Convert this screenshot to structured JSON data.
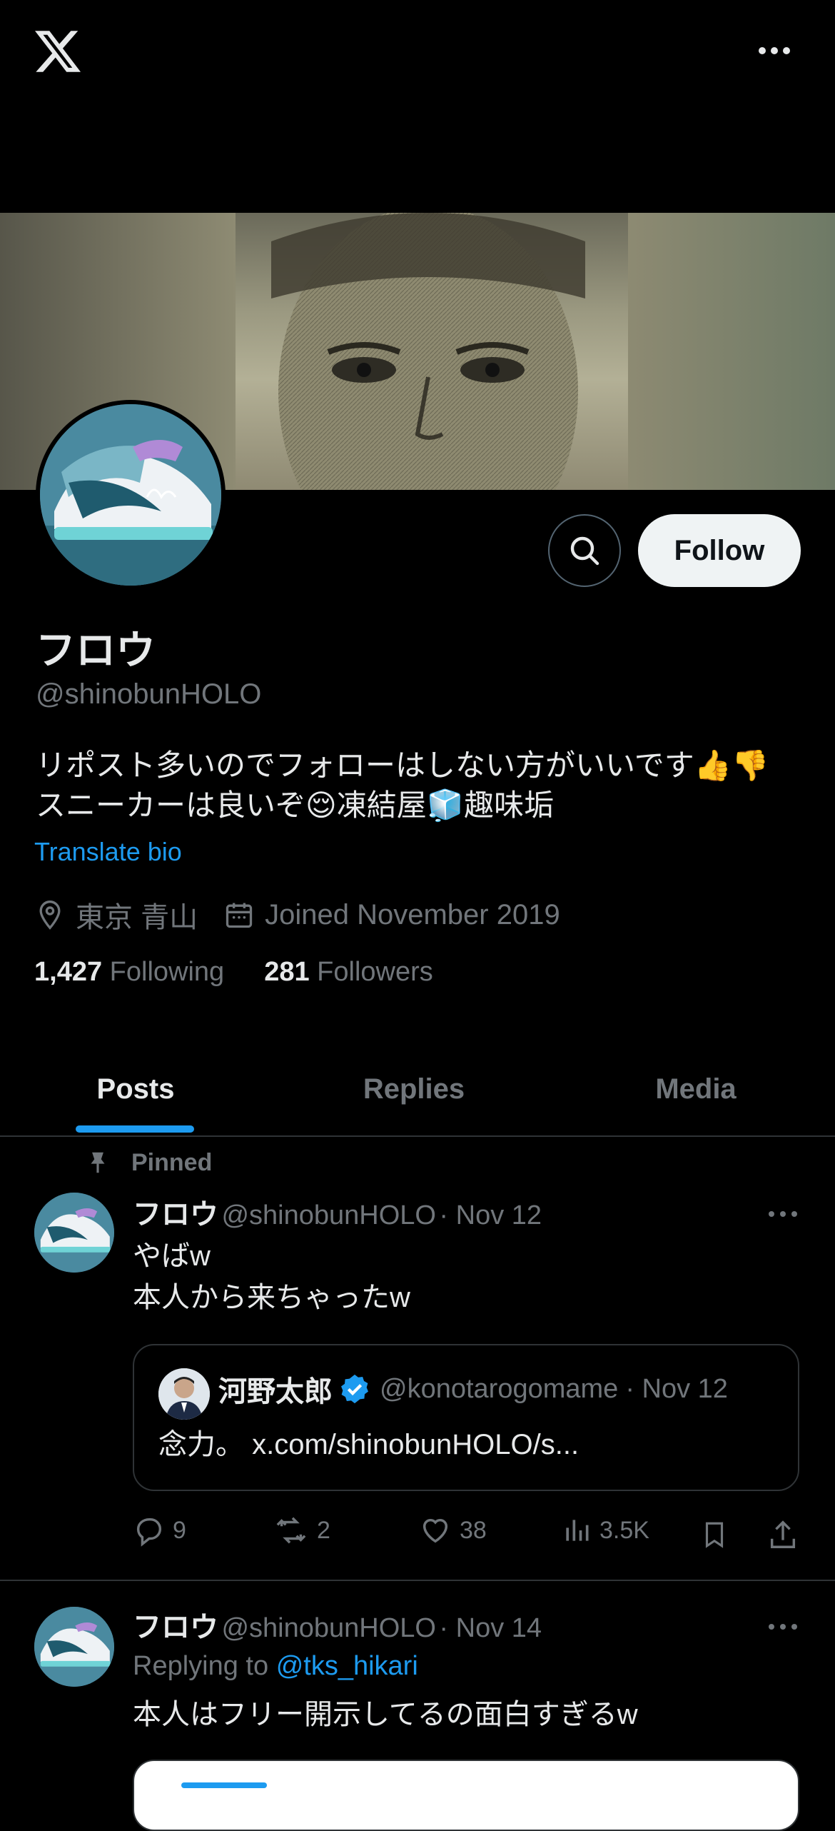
{
  "app": {
    "name": "X",
    "logo_icon": "x-logo-icon",
    "menu_icon": "more-horizontal-icon"
  },
  "profile": {
    "display_name": "フロウ",
    "handle": "@shinobunHOLO",
    "bio_line1": "リポスト多いのでフォローはしない方がいいです👍👎",
    "bio_line2": "スニーカーは良いぞ😌凍結屋🧊趣味垢",
    "translate_label": "Translate bio",
    "location": "東京 青山",
    "joined": "Joined November 2019",
    "following_count": "1,427",
    "following_label": "Following",
    "followers_count": "281",
    "followers_label": "Followers",
    "follow_button": "Follow",
    "accent_color": "#1d9bf0"
  },
  "tabs": [
    {
      "label": "Posts",
      "active": true
    },
    {
      "label": "Replies",
      "active": false
    },
    {
      "label": "Media",
      "active": false
    }
  ],
  "posts": [
    {
      "pinned_label": "Pinned",
      "name": "フロウ",
      "handle": "@shinobunHOLO",
      "date": "· Nov 12",
      "text_line1": "やばw",
      "text_line2": "本人から来ちゃったw",
      "quote": {
        "name": "河野太郎",
        "handle": "@konotarogomame",
        "date": "· Nov 12",
        "text": "念力。 x.com/shinobunHOLO/s..."
      },
      "replies": "9",
      "reposts": "2",
      "likes": "38",
      "views": "3.5K"
    },
    {
      "name": "フロウ",
      "handle": "@shinobunHOLO",
      "date": "· Nov 14",
      "replying_prefix": "Replying to",
      "replying_to": "@tks_hikari",
      "text_line1": "本人はフリー開示してるの面白すぎるw"
    }
  ]
}
